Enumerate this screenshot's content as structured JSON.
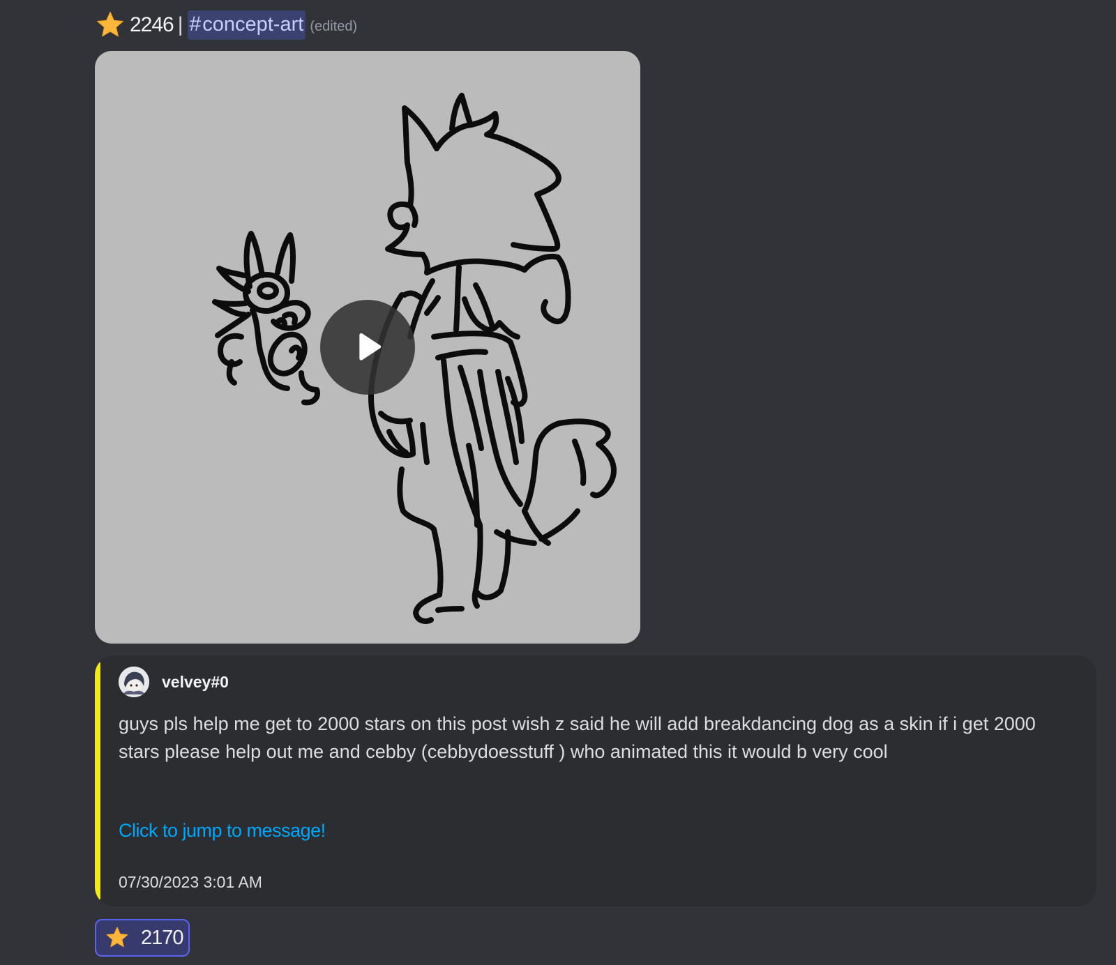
{
  "header": {
    "star_icon": "star-icon",
    "star_count": "2246",
    "separator": "|",
    "channel_hash": "#",
    "channel_name": "concept-art",
    "edited_label": "(edited)"
  },
  "media": {
    "type": "video",
    "play_icon": "play-icon",
    "background_color": "#bbbbbb"
  },
  "embed": {
    "accent_color": "#f6e71b",
    "author_name": "velvey#0",
    "description": "guys pls help me get to 2000 stars on this post wish z said he will add breakdancing dog as a skin if i get 2000 stars please help out me and cebby (cebbydoesstuff ) who animated this it would b very cool",
    "jump_link": "Click to jump to message!",
    "timestamp": "07/30/2023 3:01 AM"
  },
  "reaction": {
    "emoji_icon": "star-icon",
    "count": "2170"
  },
  "colors": {
    "background": "#313338",
    "embed_background": "#2b2d31",
    "mention_background": "#3c4270",
    "mention_text": "#c9cdfb",
    "link": "#00a8fc",
    "star": "#fbb73c",
    "reaction_border": "#5865f2"
  }
}
